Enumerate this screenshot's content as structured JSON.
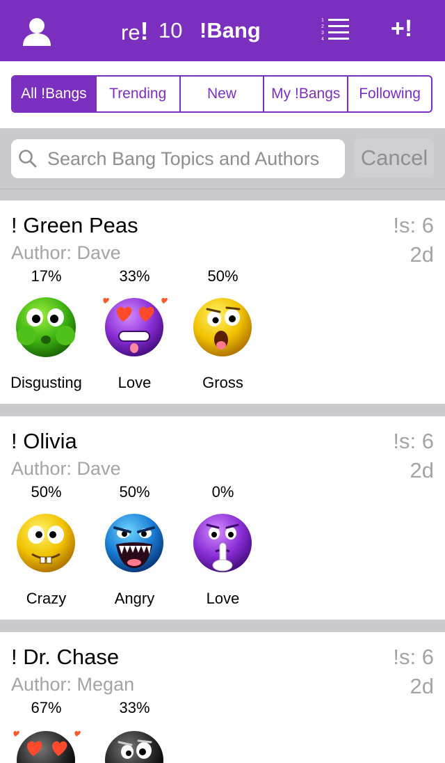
{
  "header": {
    "brand_re": "re",
    "brand_exclaim": "!",
    "brand_count": "10",
    "brand_name": "!Bang",
    "add_label": "+!",
    "profile_icon": "person-icon",
    "list_icon": "numbered-list-icon",
    "list_icon_digits": [
      "1",
      "2",
      "3",
      "4"
    ]
  },
  "tabs": {
    "items": [
      "All !Bangs",
      "Trending",
      "New",
      "My !Bangs",
      "Following"
    ],
    "active": "All !Bangs"
  },
  "search": {
    "placeholder": "Search Bang Topics and Authors",
    "value": "",
    "cancel_label": "Cancel"
  },
  "colors": {
    "accent": "#7b2fbe",
    "muted_text": "#a4a4a4",
    "separator": "#c9c9ce"
  },
  "cards": [
    {
      "title": "! Green Peas",
      "author": "Author: Dave",
      "count": "!s: 6",
      "age": "2d",
      "reactions": [
        {
          "percent": "17%",
          "label": "Disgusting",
          "emoji": "green-disgusted-face"
        },
        {
          "percent": "33%",
          "label": "Love",
          "emoji": "purple-heart-eyes-face"
        },
        {
          "percent": "50%",
          "label": "Gross",
          "emoji": "yellow-gross-face"
        }
      ]
    },
    {
      "title": "! Olivia",
      "author": "Author: Dave",
      "count": "!s: 6",
      "age": "2d",
      "reactions": [
        {
          "percent": "50%",
          "label": "Crazy",
          "emoji": "yellow-crazy-face"
        },
        {
          "percent": "50%",
          "label": "Angry",
          "emoji": "blue-angry-face"
        },
        {
          "percent": "0%",
          "label": "Love",
          "emoji": "purple-shush-face"
        }
      ]
    },
    {
      "title": "! Dr. Chase",
      "author": "Author: Megan",
      "count": "!s: 6",
      "age": "2d",
      "reactions": [
        {
          "percent": "67%",
          "label": "",
          "emoji": "black-heart-eyes-face"
        },
        {
          "percent": "33%",
          "label": "",
          "emoji": "black-worried-face"
        }
      ]
    }
  ]
}
